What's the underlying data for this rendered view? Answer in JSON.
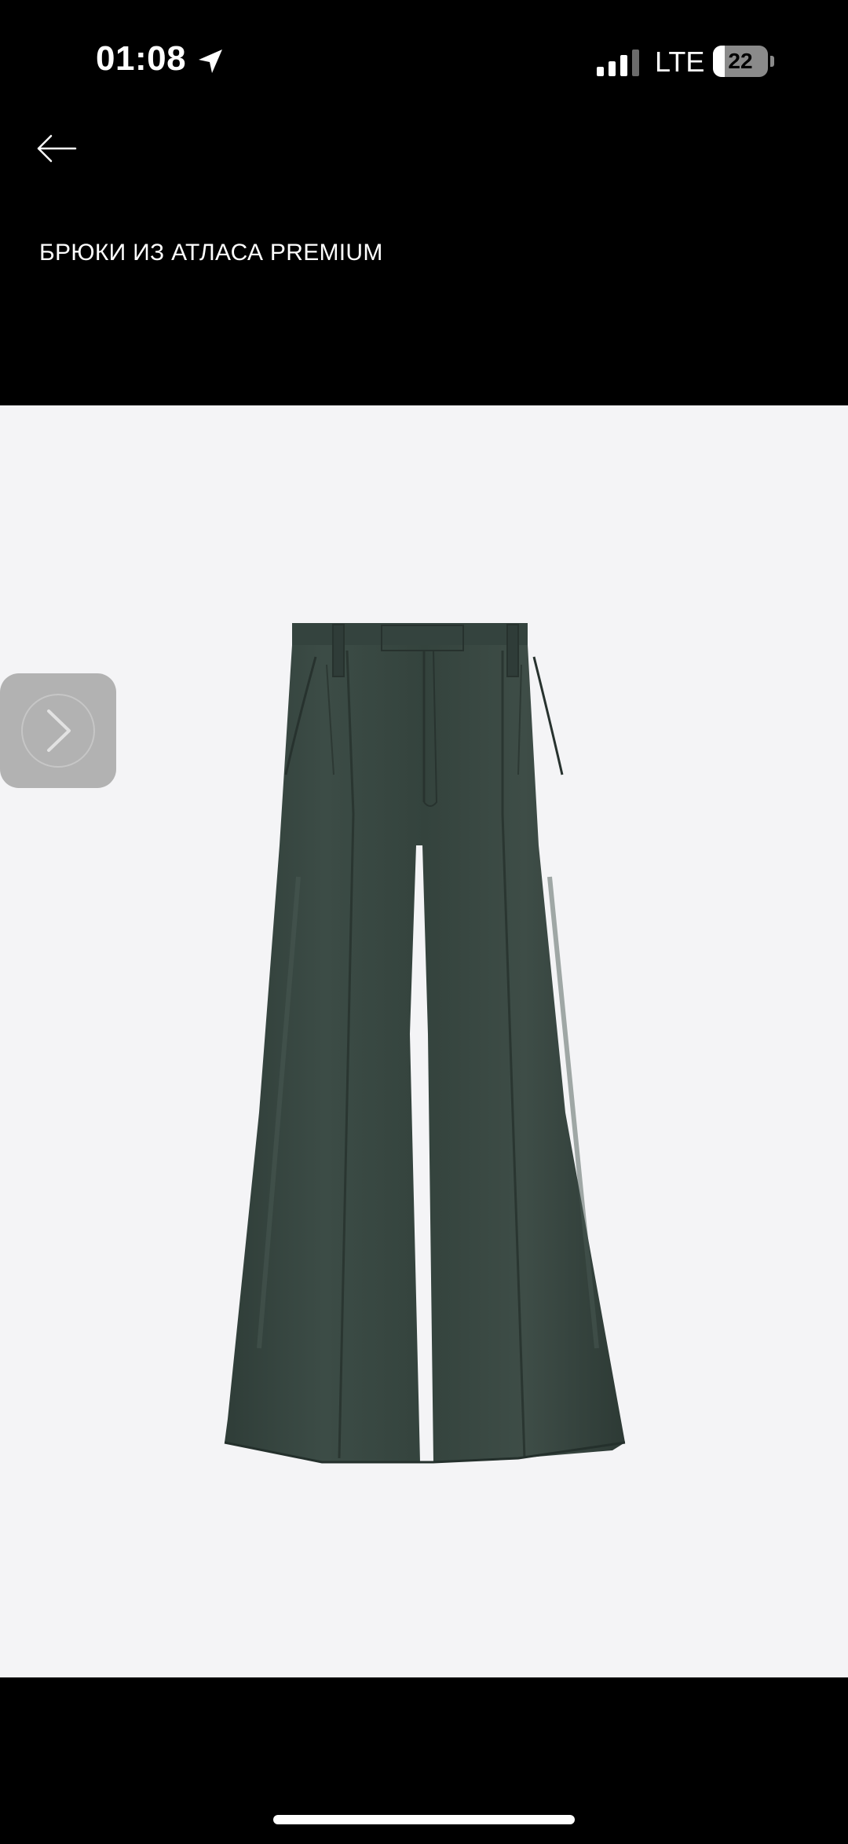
{
  "status_bar": {
    "time": "01:08",
    "network": "LTE",
    "battery_level": "22",
    "battery_fraction": 0.22,
    "signal_bars_active": 3,
    "signal_bars_total": 4,
    "icons": [
      "location-arrow-icon",
      "signal-icon",
      "battery-icon"
    ]
  },
  "header": {
    "back_icon": "arrow-left-icon",
    "title": "БРЮКИ ИЗ АТЛАСА PREMIUM"
  },
  "product_image": {
    "subject": "wide-leg pleated satin trousers",
    "garment_color": "#36453f",
    "background_color": "#f4f4f6"
  },
  "gallery": {
    "next_icon": "chevron-right-icon"
  },
  "colors": {
    "screen_background": "#000000",
    "text": "#ffffff",
    "overlay_button": "#b2b2b2"
  }
}
